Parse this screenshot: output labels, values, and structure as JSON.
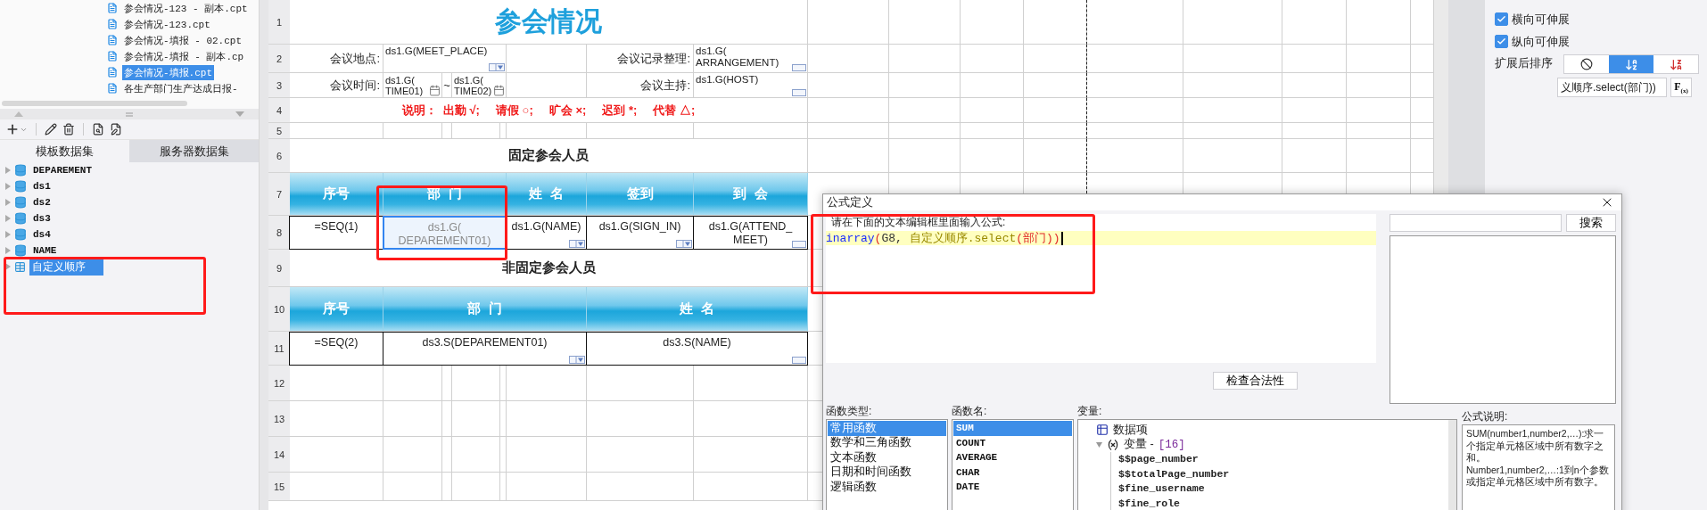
{
  "file_list": {
    "items": [
      {
        "name": "参会情况-123 - 副本.cpt",
        "selected": false
      },
      {
        "name": "参会情况-123.cpt",
        "selected": false
      },
      {
        "name": "参会情况-填报 - 02.cpt",
        "selected": false
      },
      {
        "name": "参会情况-填报 - 副本.cp",
        "selected": false
      },
      {
        "name": "参会情况-填报.cpt",
        "selected": true
      },
      {
        "name": "各生产部门生产达成日报-",
        "selected": false
      }
    ]
  },
  "dataset_panel": {
    "tabs": [
      {
        "label": "模板数据集",
        "selected": true
      },
      {
        "label": "服务器数据集",
        "selected": false
      }
    ],
    "items": [
      {
        "name": "DEPAREMENT",
        "kind": "database",
        "selected": false
      },
      {
        "name": "ds1",
        "kind": "database",
        "selected": false
      },
      {
        "name": "ds2",
        "kind": "database",
        "selected": false
      },
      {
        "name": "ds3",
        "kind": "database",
        "selected": false
      },
      {
        "name": "ds4",
        "kind": "database",
        "selected": false
      },
      {
        "name": "NAME",
        "kind": "database",
        "selected": false
      },
      {
        "name": "自定义顺序",
        "kind": "table",
        "selected": true
      }
    ]
  },
  "sheet": {
    "rows": [
      {
        "number": "1",
        "cells": [
          {
            "kind": "title",
            "text": "参会情况",
            "selected": false
          }
        ]
      },
      {
        "number": "2",
        "cells": [
          {
            "kind": "label",
            "text": "会议地点:",
            "selected": false
          },
          {
            "kind": "value",
            "text": "ds1.G(MEET_PLACE)",
            "widget": {
              "kind": "dropdown"
            },
            "selected": false
          },
          {
            "kind": "label",
            "text": "会议记录整理:",
            "selected": false
          },
          {
            "kind": "value",
            "text": "ds1.G(\nARRANGEMENT)",
            "widget": {
              "kind": "textbox"
            },
            "selected": false
          }
        ]
      },
      {
        "number": "3",
        "cells": [
          {
            "kind": "label",
            "text": "会议时间:",
            "selected": false
          },
          {
            "kind": "date",
            "text": "ds1.G(\nTIME01)",
            "widget": {
              "kind": "date"
            },
            "selected": false
          },
          {
            "kind": "plain",
            "text": "~",
            "selected": false
          },
          {
            "kind": "date",
            "text": "ds1.G(\nTIME02)",
            "widget": {
              "kind": "date"
            },
            "selected": false
          },
          {
            "kind": "label",
            "text": "会议主持:",
            "selected": false
          },
          {
            "kind": "value",
            "text": "ds1.G(HOST)",
            "widget": {
              "kind": "textbox"
            },
            "selected": false
          }
        ]
      },
      {
        "number": "4",
        "cells": [
          {
            "kind": "note",
            "text": "说明：  出勤 √;     请假 ○;     旷会 ×;     迟到 *;     代替 △;",
            "selected": false
          }
        ]
      },
      {
        "number": "5"
      },
      {
        "number": "6",
        "cells": [
          {
            "kind": "section",
            "text": "固定参会人员",
            "selected": false
          }
        ]
      },
      {
        "number": "7",
        "cells": [
          {
            "kind": "header",
            "text": "序号",
            "selected": false
          },
          {
            "kind": "header",
            "text": "部  门",
            "selected": false
          },
          {
            "kind": "header",
            "text": "姓  名",
            "selected": false
          },
          {
            "kind": "header",
            "text": "签到",
            "selected": false
          },
          {
            "kind": "header",
            "text": "到  会",
            "selected": false
          }
        ]
      },
      {
        "number": "8",
        "cells": [
          {
            "kind": "data",
            "text": "=SEQ(1)",
            "selected": false
          },
          {
            "kind": "data",
            "text": "ds1.G(\nDEPAREMENT01)",
            "selected": true
          },
          {
            "kind": "data",
            "text": "ds1.G(NAME)",
            "widget": {
              "kind": "dropdown"
            },
            "selected": false
          },
          {
            "kind": "data",
            "text": "ds1.G(SIGN_IN)",
            "widget": {
              "kind": "dropdown"
            },
            "selected": false
          },
          {
            "kind": "data",
            "text": "ds1.G(ATTEND_\nMEET)",
            "widget": {
              "kind": "textbox"
            },
            "selected": false
          }
        ]
      },
      {
        "number": "9",
        "cells": [
          {
            "kind": "section",
            "text": "非固定参会人员",
            "selected": false
          }
        ]
      },
      {
        "number": "10",
        "cells": [
          {
            "kind": "header",
            "text": "序号",
            "selected": false
          },
          {
            "kind": "header",
            "text": "部  门",
            "selected": false
          },
          {
            "kind": "header",
            "text": "姓  名",
            "selected": false
          }
        ]
      },
      {
        "number": "11",
        "cells": [
          {
            "kind": "data",
            "text": "=SEQ(2)",
            "selected": false
          },
          {
            "kind": "data",
            "text": "ds3.S(DEPAREMENT01)",
            "widget": {
              "kind": "dropdown"
            },
            "selected": false
          },
          {
            "kind": "data",
            "text": "ds3.S(NAME)",
            "widget": {
              "kind": "textbox"
            },
            "selected": false
          }
        ]
      },
      {
        "number": "12"
      },
      {
        "number": "13"
      },
      {
        "number": "14"
      },
      {
        "number": "15"
      }
    ]
  },
  "cell_properties": {
    "checkboxes": [
      {
        "label": "横向可伸展",
        "checked": true
      },
      {
        "label": "纵向可伸展",
        "checked": true
      }
    ],
    "sort_label": "扩展后排序",
    "sort_options": [
      {
        "kind": "none",
        "selected": false
      },
      {
        "kind": "ascending",
        "selected": true
      },
      {
        "kind": "descending",
        "selected": false
      }
    ],
    "formula_value": "义顺序.select(部门))",
    "formula_button": "F$_{(x)}$"
  },
  "formula_dialog": {
    "title": "公式定义",
    "instruction": "请在下面的文本编辑框里面输入公式:",
    "formula": [
      {
        "kind": "function",
        "text": "inarray"
      },
      {
        "kind": "paren",
        "text": "("
      },
      {
        "kind": "reference",
        "text": "G8, "
      },
      {
        "kind": "expression",
        "text": "自定义顺序.select"
      },
      {
        "kind": "paren",
        "text": "(部门))"
      }
    ],
    "search_button": "搜索",
    "check_button": "检查合法性",
    "function_type_label": "函数类型:",
    "function_types": [
      {
        "label": "常用函数",
        "selected": true
      },
      {
        "label": "数学和三角函数",
        "selected": false
      },
      {
        "label": "文本函数",
        "selected": false
      },
      {
        "label": "日期和时间函数",
        "selected": false
      },
      {
        "label": "逻辑函数",
        "selected": false
      }
    ],
    "function_name_label": "函数名:",
    "function_names": [
      {
        "label": "SUM",
        "selected": true
      },
      {
        "label": "COUNT",
        "selected": false
      },
      {
        "label": "AVERAGE",
        "selected": false
      },
      {
        "label": "CHAR",
        "selected": false
      },
      {
        "label": "DATE",
        "selected": false
      }
    ],
    "variable_label": "变量:",
    "variables": [
      {
        "label": "数据项",
        "kind": "data"
      },
      {
        "label": "变量 -",
        "count": "[16]",
        "kind": "variable",
        "expanded": true,
        "children": [
          {
            "label": "$$page_number"
          },
          {
            "label": "$$totalPage_number"
          },
          {
            "label": "$fine_username"
          },
          {
            "label": "$fine_role"
          }
        ]
      }
    ],
    "description_label": "公式说明:",
    "description": [
      "SUM(number1,number2,…):求一个指定单元格区域中所有数字之和。",
      "Number1,number2,…:1到n个参数或指定单元格区域中所有数字。"
    ]
  }
}
